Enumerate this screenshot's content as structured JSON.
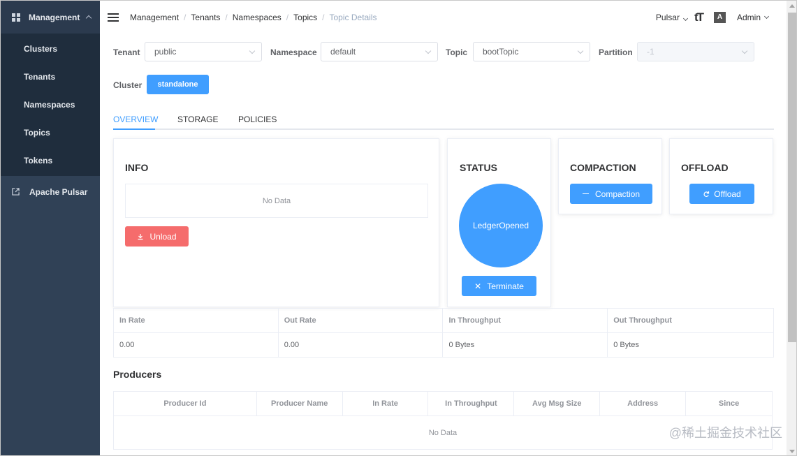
{
  "sidebar": {
    "header": "Management",
    "items": [
      {
        "label": "Clusters"
      },
      {
        "label": "Tenants"
      },
      {
        "label": "Namespaces"
      },
      {
        "label": "Topics"
      },
      {
        "label": "Tokens"
      }
    ],
    "external_link": "Apache Pulsar"
  },
  "breadcrumb": {
    "items": [
      "Management",
      "Tenants",
      "Namespaces",
      "Topics"
    ],
    "current": "Topic Details"
  },
  "header": {
    "env_select": "Pulsar",
    "size_icon": "tT",
    "lang_icon": "A",
    "user": "Admin"
  },
  "filters": {
    "tenant_label": "Tenant",
    "tenant_value": "public",
    "namespace_label": "Namespace",
    "namespace_value": "default",
    "topic_label": "Topic",
    "topic_value": "bootTopic",
    "partition_label": "Partition",
    "partition_value": "-1",
    "cluster_label": "Cluster",
    "cluster_value": "standalone"
  },
  "tabs": [
    "OVERVIEW",
    "STORAGE",
    "POLICIES"
  ],
  "info": {
    "title": "INFO",
    "empty": "No Data",
    "unload_label": "Unload"
  },
  "status": {
    "title": "STATUS",
    "state": "LedgerOpened",
    "terminate_label": "Terminate"
  },
  "compaction": {
    "title": "COMPACTION",
    "button_label": "Compaction"
  },
  "offload": {
    "title": "OFFLOAD",
    "button_label": "Offload"
  },
  "stats": {
    "headers": [
      "In Rate",
      "Out Rate",
      "In Throughput",
      "Out Throughput"
    ],
    "values": [
      "0.00",
      "0.00",
      "0 Bytes",
      "0 Bytes"
    ]
  },
  "producers": {
    "title": "Producers",
    "columns": [
      "Producer Id",
      "Producer Name",
      "In Rate",
      "In Throughput",
      "Avg Msg Size",
      "Address",
      "Since"
    ],
    "empty": "No Data"
  },
  "watermark": "@稀土掘金技术社区",
  "colors": {
    "sidebar_bg": "#304156",
    "primary": "#409eff",
    "danger": "#f56c6c"
  }
}
